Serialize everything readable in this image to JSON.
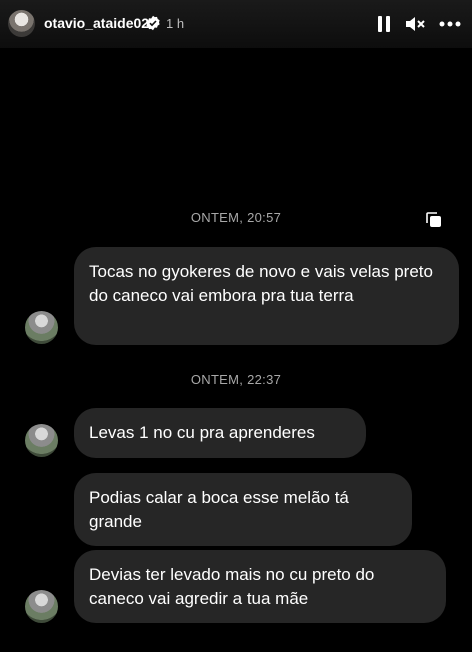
{
  "header": {
    "username": "otavio_ataide02",
    "time": "1 h"
  },
  "icons": {
    "avatar": "profile-avatar",
    "verified": "verified-badge-icon",
    "pause": "pause-icon",
    "mute": "speaker-muted-icon",
    "more": "more-dots-icon",
    "copy": "copy-icon"
  },
  "messages": {
    "stamp1": "ONTEM, 20:57",
    "m1": "Tocas no gyokeres de novo e vais velas preto do caneco vai embora pra tua terra",
    "stamp2": "ONTEM, 22:37",
    "m2": "Levas 1 no cu pra aprenderes",
    "m3": "Podias calar a boca esse melão tá grande",
    "m4": "Devias ter levado mais no cu preto do caneco vai agredir a tua mãe"
  },
  "colors": {
    "background": "#000000",
    "bubble": "#262626",
    "timestamp": "#a8a8a8"
  }
}
